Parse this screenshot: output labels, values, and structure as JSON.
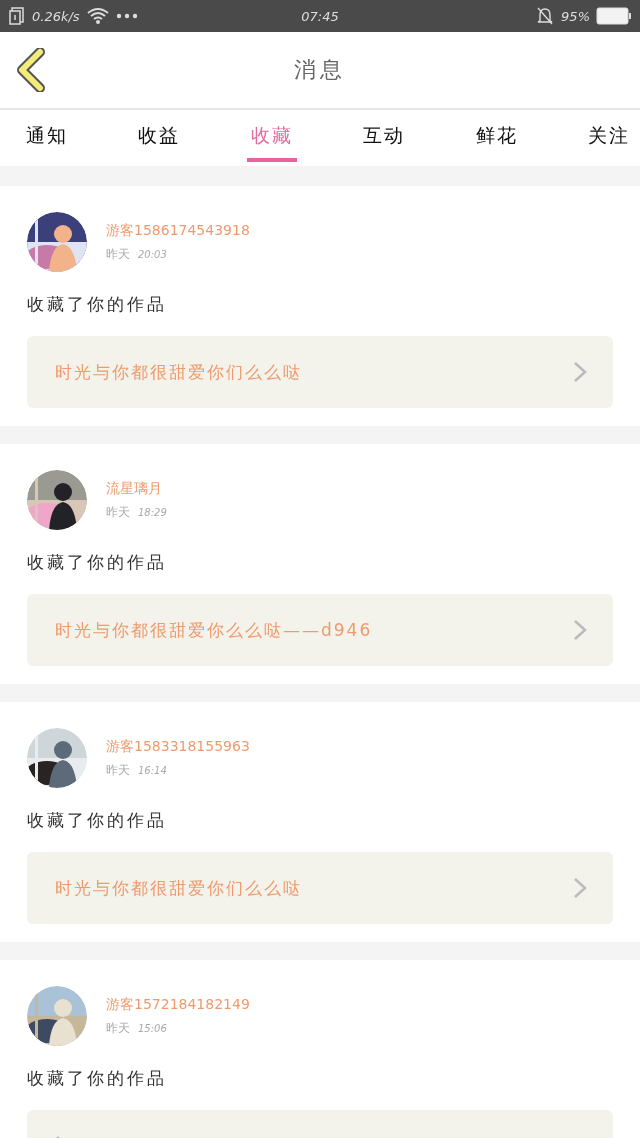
{
  "status_bar": {
    "speed": "0.26k/s",
    "time": "07:45",
    "battery": "95%"
  },
  "header": {
    "title": "消息"
  },
  "tabs": [
    {
      "label": "通知",
      "selected": false
    },
    {
      "label": "收益",
      "selected": false
    },
    {
      "label": "收藏",
      "selected": true
    },
    {
      "label": "互动",
      "selected": false
    },
    {
      "label": "鲜花",
      "selected": false
    },
    {
      "label": "关注",
      "selected": false
    }
  ],
  "messages": [
    {
      "name": "游客1586174543918",
      "day": "昨天",
      "time": "20:03",
      "action": "收藏了你的作品",
      "work": {
        "title": "时光与你都很甜爱你们么么哒"
      }
    },
    {
      "name": "流星璃月",
      "day": "昨天",
      "time": "18:29",
      "action": "收藏了你的作品",
      "work": {
        "title": "时光与你都很甜爱你么么哒——d946"
      }
    },
    {
      "name": "游客1583318155963",
      "day": "昨天",
      "time": "16:14",
      "action": "收藏了你的作品",
      "work": {
        "title": "时光与你都很甜爱你们么么哒"
      }
    },
    {
      "name": "游客1572184182149",
      "day": "昨天",
      "time": "15:06",
      "action": "收藏了你的作品"
    }
  ]
}
